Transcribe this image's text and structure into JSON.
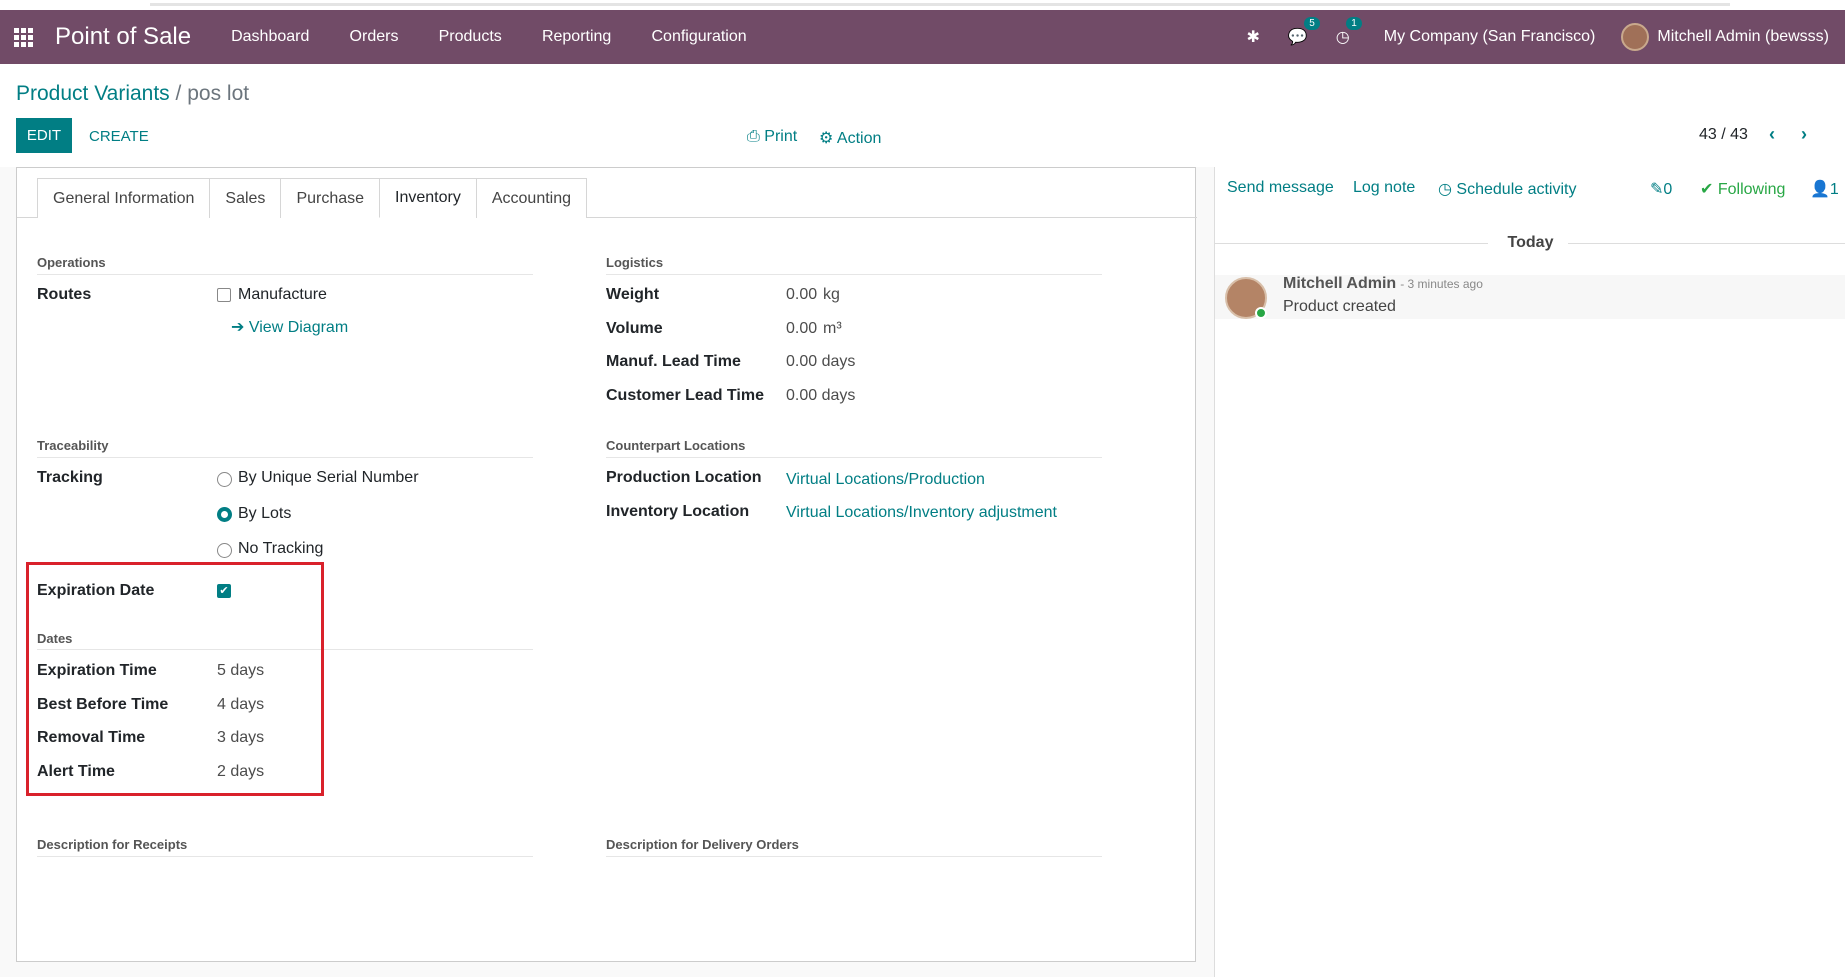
{
  "topbar": {
    "app_name": "Point of Sale",
    "menu": [
      "Dashboard",
      "Orders",
      "Products",
      "Reporting",
      "Configuration"
    ],
    "messages_badge": "5",
    "activity_badge": "1",
    "company": "My Company (San Francisco)",
    "user": "Mitchell Admin (bewsss)"
  },
  "control_panel": {
    "breadcrumb_parent": "Product Variants",
    "breadcrumb_sep": "/",
    "breadcrumb_current": "pos lot",
    "edit_label": "EDIT",
    "create_label": "CREATE",
    "print_label": "Print",
    "action_label": "Action",
    "pager": "43 / 43"
  },
  "tabs": [
    "General Information",
    "Sales",
    "Purchase",
    "Inventory",
    "Accounting"
  ],
  "operations": {
    "title": "Operations",
    "routes_label": "Routes",
    "manufacture_label": "Manufacture",
    "manufacture_checked": false,
    "view_diagram": "View Diagram"
  },
  "logistics": {
    "title": "Logistics",
    "weight_label": "Weight",
    "weight_value": "0.00",
    "weight_unit": "kg",
    "volume_label": "Volume",
    "volume_value": "0.00",
    "volume_unit": "m³",
    "manuf_label": "Manuf. Lead Time",
    "manuf_value": "0.00 days",
    "customer_label": "Customer Lead Time",
    "customer_value": "0.00 days"
  },
  "traceability": {
    "title": "Traceability",
    "tracking_label": "Tracking",
    "options": [
      "By Unique Serial Number",
      "By Lots",
      "No Tracking"
    ],
    "selected": "By Lots",
    "expiration_label": "Expiration Date",
    "expiration_checked": true
  },
  "counterpart": {
    "title": "Counterpart Locations",
    "production_label": "Production Location",
    "production_value": "Virtual Locations/Production",
    "inventory_label": "Inventory Location",
    "inventory_value": "Virtual Locations/Inventory adjustment"
  },
  "dates": {
    "title": "Dates",
    "expiration_time_label": "Expiration Time",
    "expiration_time": "5 days",
    "best_before_label": "Best Before Time",
    "best_before": "4 days",
    "removal_label": "Removal Time",
    "removal": "3 days",
    "alert_label": "Alert Time",
    "alert": "2 days"
  },
  "descriptions": {
    "receipts": "Description for Receipts",
    "delivery": "Description for Delivery Orders"
  },
  "chatter": {
    "send_message": "Send message",
    "log_note": "Log note",
    "schedule_activity": "Schedule activity",
    "attachments": "0",
    "following": "Following",
    "followers": "1",
    "today": "Today",
    "message_author": "Mitchell Admin",
    "message_time": "- 3 minutes ago",
    "message_body": "Product created"
  },
  "colors": {
    "brand": "#714b67",
    "accent": "#017e84",
    "highlight": "#d9212b"
  }
}
